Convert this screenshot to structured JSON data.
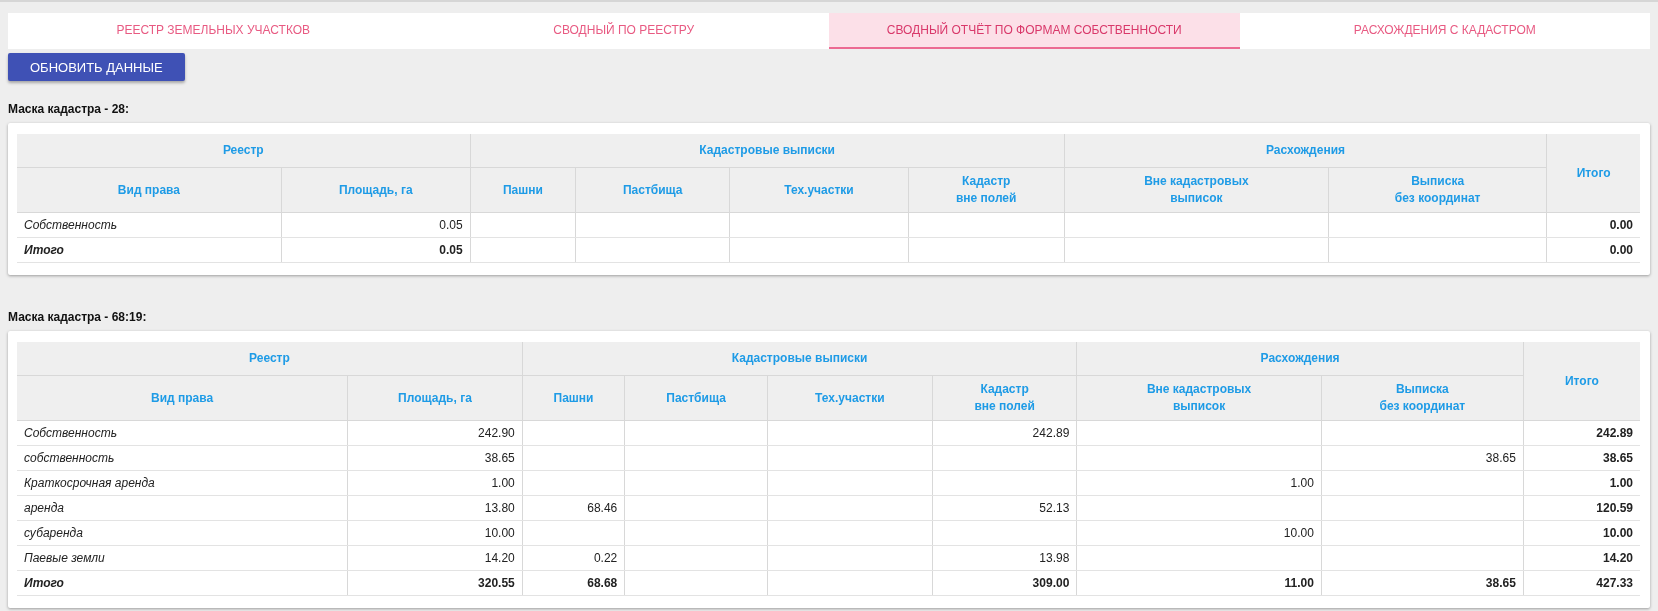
{
  "tabs": [
    {
      "label": "РЕЕСТР ЗЕМЕЛЬНЫХ УЧАСТКОВ",
      "selected": false
    },
    {
      "label": "СВОДНЫЙ ПО РЕЕСТРУ",
      "selected": false
    },
    {
      "label": "СВОДНЫЙ ОТЧЁТ ПО ФОРМАМ СОБСТВЕННОСТИ",
      "selected": true
    },
    {
      "label": "РАСХОЖДЕНИЯ С КАДАСТРОМ",
      "selected": false
    }
  ],
  "refresh_button": "ОБНОВИТЬ ДАННЫЕ",
  "sections": [
    {
      "title": "Маска кадастра - 28:",
      "table": {
        "groups": [
          {
            "label": "Реестр",
            "columns": [
              "Вид права",
              "Площадь, га"
            ]
          },
          {
            "label": "Кадастровые выписки",
            "columns": [
              "Пашни",
              "Пастбища",
              "Тех.участки",
              "Кадастр\nвне полей"
            ]
          },
          {
            "label": "Расхождения",
            "columns": [
              "Вне кадастровых\nвыписок",
              "Выписка\nбез координат"
            ]
          },
          {
            "label": "Итого"
          }
        ],
        "rows": [
          {
            "kind": "item",
            "cells": [
              "Собственность",
              "0.05",
              null,
              null,
              null,
              null,
              null,
              null,
              "0.00"
            ]
          },
          {
            "kind": "total",
            "cells": [
              "Итого",
              "0.05",
              null,
              null,
              null,
              null,
              null,
              null,
              "0.00"
            ]
          }
        ]
      }
    },
    {
      "title": "Маска кадастра - 68:19:",
      "table": {
        "groups": [
          {
            "label": "Реестр",
            "columns": [
              "Вид права",
              "Площадь, га"
            ]
          },
          {
            "label": "Кадастровые выписки",
            "columns": [
              "Пашни",
              "Пастбища",
              "Тех.участки",
              "Кадастр\nвне полей"
            ]
          },
          {
            "label": "Расхождения",
            "columns": [
              "Вне кадастровых\nвыписок",
              "Выписка\nбез координат"
            ]
          },
          {
            "label": "Итого"
          }
        ],
        "rows": [
          {
            "kind": "item",
            "cells": [
              "Собственность",
              "242.90",
              null,
              null,
              null,
              "242.89",
              null,
              null,
              "242.89"
            ]
          },
          {
            "kind": "item",
            "cells": [
              "собственность",
              "38.65",
              null,
              null,
              null,
              null,
              null,
              "38.65",
              "38.65"
            ]
          },
          {
            "kind": "item",
            "cells": [
              "Краткосрочная аренда",
              "1.00",
              null,
              null,
              null,
              null,
              "1.00",
              null,
              "1.00"
            ]
          },
          {
            "kind": "item",
            "cells": [
              "аренда",
              "13.80",
              "68.46",
              null,
              null,
              "52.13",
              null,
              null,
              "120.59"
            ]
          },
          {
            "kind": "item",
            "cells": [
              "субаренда",
              "10.00",
              null,
              null,
              null,
              null,
              "10.00",
              null,
              "10.00"
            ]
          },
          {
            "kind": "item",
            "cells": [
              "Паевые земли",
              "14.20",
              "0.22",
              null,
              null,
              "13.98",
              null,
              null,
              "14.20"
            ]
          },
          {
            "kind": "total",
            "cells": [
              "Итого",
              "320.55",
              "68.68",
              null,
              null,
              "309.00",
              "11.00",
              "38.65",
              "427.33"
            ]
          }
        ]
      }
    }
  ]
}
